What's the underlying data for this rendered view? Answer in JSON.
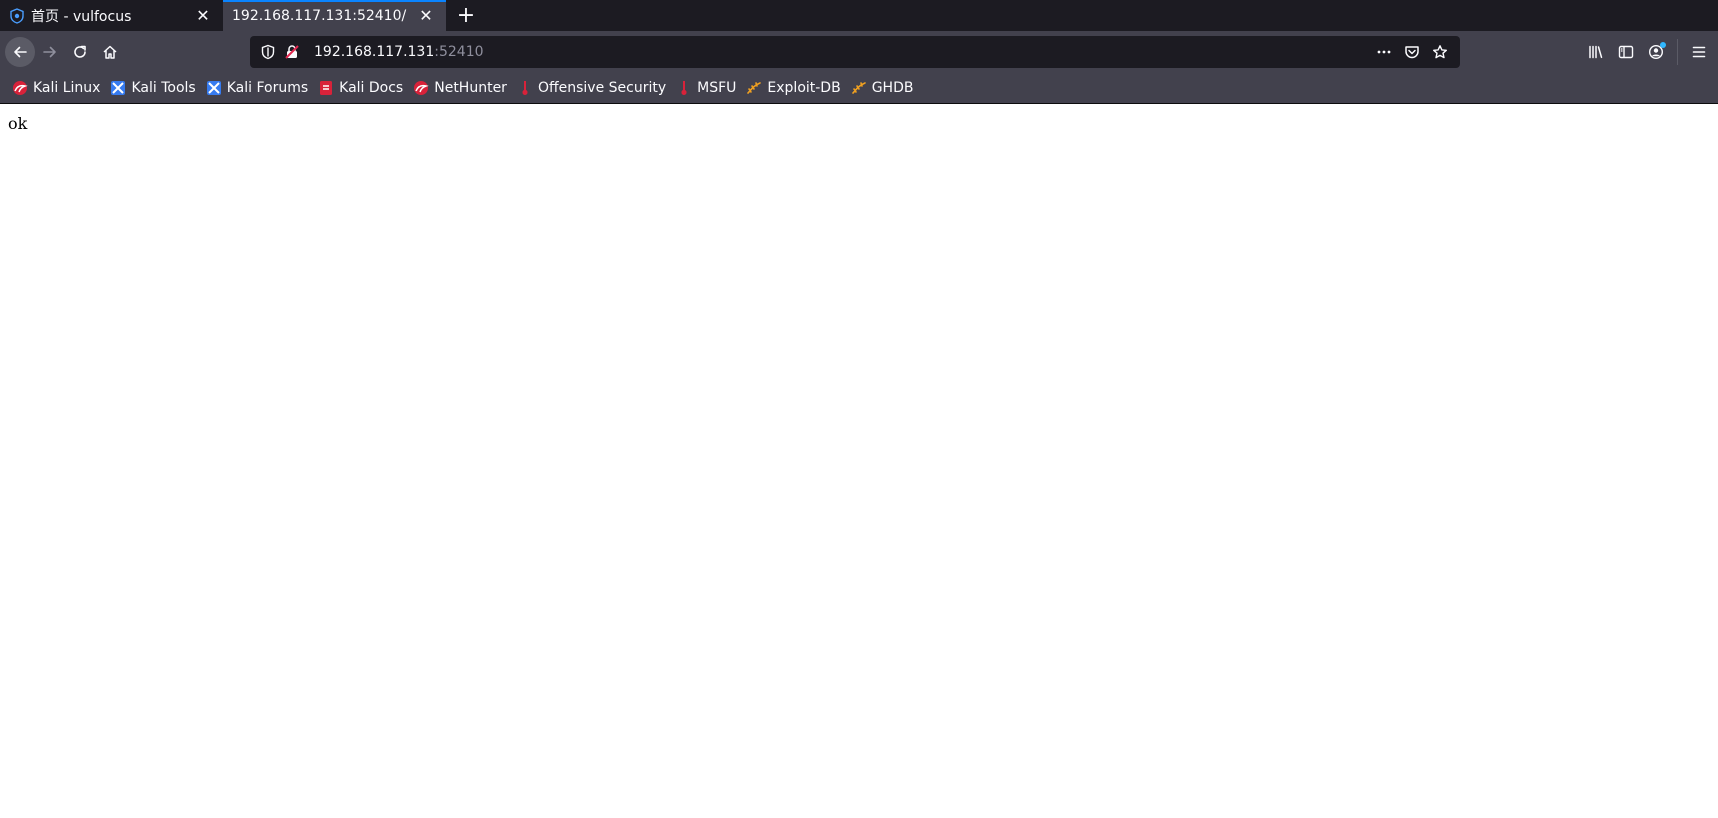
{
  "tabs": [
    {
      "title": "首页 - vulfocus",
      "icon": "vulfocus-shield-icon",
      "active": false
    },
    {
      "title": "192.168.117.131:52410/",
      "icon": "",
      "active": true
    }
  ],
  "urlbar": {
    "host": "192.168.117.131",
    "port": ":52410"
  },
  "bookmarks": [
    {
      "label": "Kali Linux",
      "icon": "kali-dragon-icon"
    },
    {
      "label": "Kali Tools",
      "icon": "kali-tools-icon"
    },
    {
      "label": "Kali Forums",
      "icon": "kali-forums-icon"
    },
    {
      "label": "Kali Docs",
      "icon": "kali-docs-icon"
    },
    {
      "label": "NetHunter",
      "icon": "nethunter-icon"
    },
    {
      "label": "Offensive Security",
      "icon": "offsec-icon"
    },
    {
      "label": "MSFU",
      "icon": "msfu-icon"
    },
    {
      "label": "Exploit-DB",
      "icon": "exploit-db-icon"
    },
    {
      "label": "GHDB",
      "icon": "ghdb-icon"
    }
  ],
  "page": {
    "body_text": "ok"
  },
  "colors": {
    "tab_accent": "#0a84ff",
    "chrome_bg": "#42414d",
    "tabstrip_bg": "#1c1b22",
    "notification_dot": "#30b8ff"
  }
}
